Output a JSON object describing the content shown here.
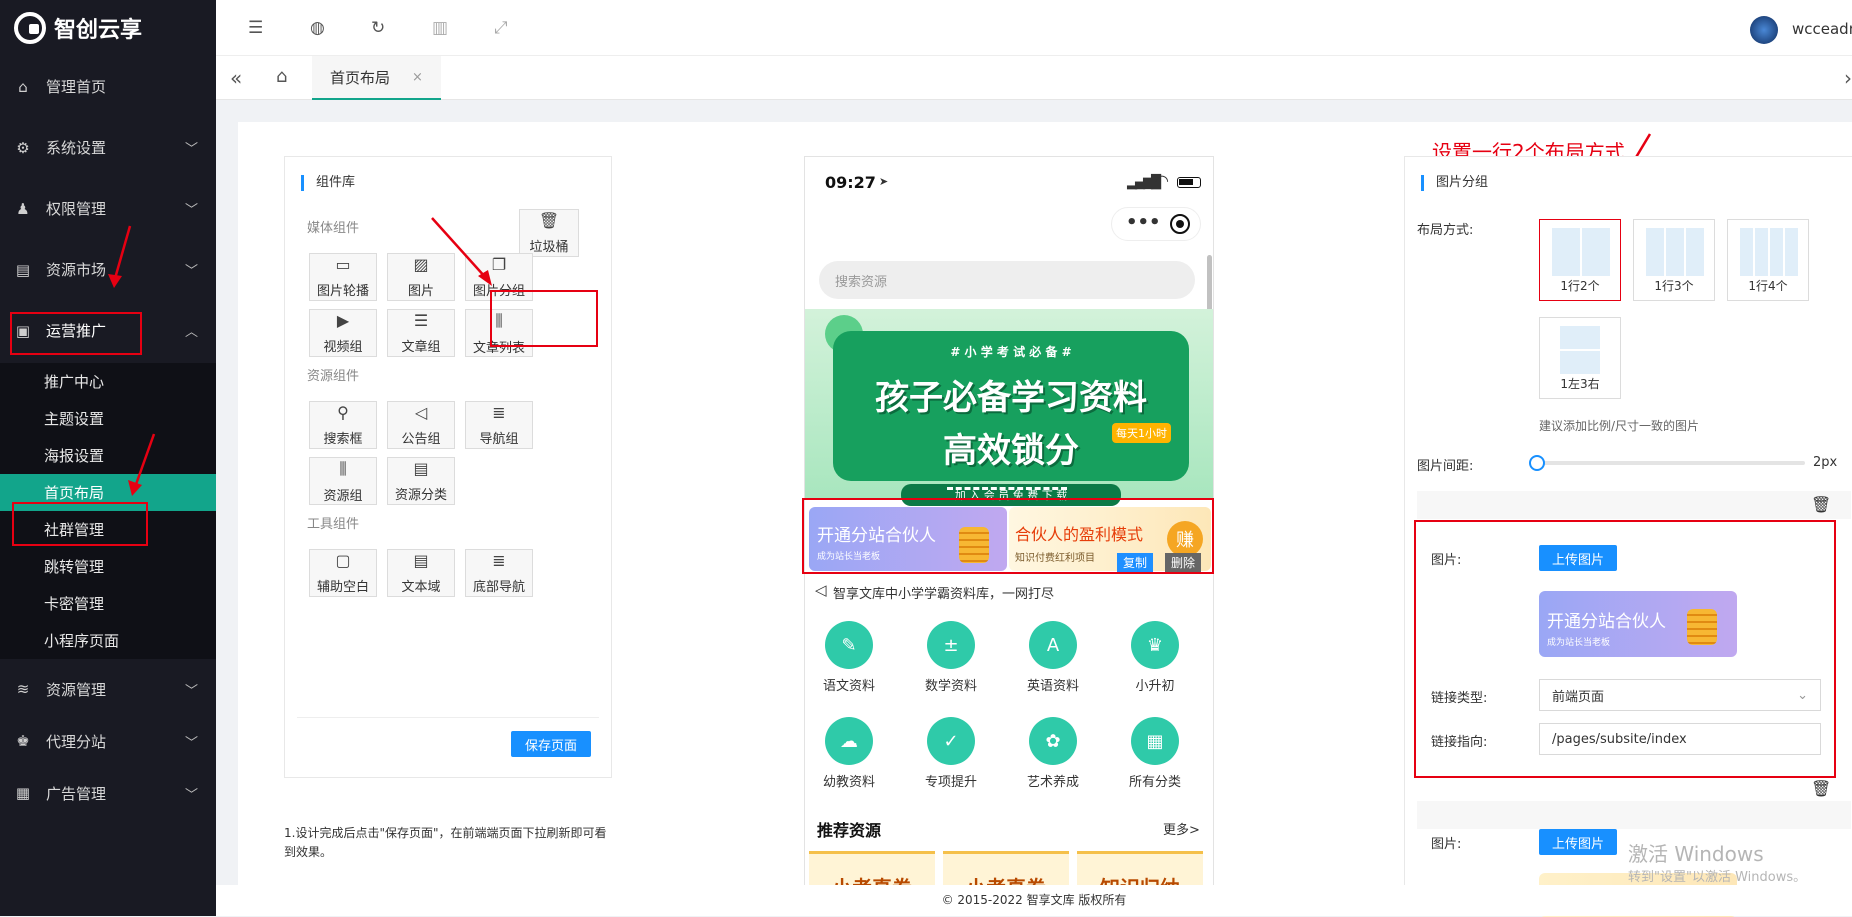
{
  "brand": {
    "name": "智创云享"
  },
  "sidebar": {
    "items": [
      {
        "label": "管理首页",
        "icon": "home-icon",
        "glyph": "⌂"
      },
      {
        "label": "系统设置",
        "icon": "gear-icon",
        "glyph": "⚙"
      },
      {
        "label": "权限管理",
        "icon": "users-icon",
        "glyph": "♟"
      },
      {
        "label": "资源市场",
        "icon": "store-icon",
        "glyph": "▤"
      },
      {
        "label": "运营推广",
        "icon": "promotion-icon",
        "glyph": "▣"
      }
    ],
    "sub_items": [
      "推广中心",
      "主题设置",
      "海报设置",
      "首页布局",
      "社群管理",
      "跳转管理",
      "卡密管理",
      "小程序页面"
    ],
    "bottom_items": [
      {
        "label": "资源管理",
        "icon": "layers-icon",
        "glyph": "≋"
      },
      {
        "label": "代理分站",
        "icon": "agent-icon",
        "glyph": "♚"
      },
      {
        "label": "广告管理",
        "icon": "ad-icon",
        "glyph": "▦"
      }
    ]
  },
  "topbar": {
    "user": "wcceadmin"
  },
  "tabs": [
    {
      "label": "首页布局"
    }
  ],
  "library": {
    "title": "组件库",
    "trash": "垃圾桶",
    "groups": [
      {
        "title": "媒体组件",
        "items": [
          {
            "label": "图片轮播",
            "glyph": "▭"
          },
          {
            "label": "图片",
            "glyph": "▨"
          },
          {
            "label": "图片分组",
            "glyph": "❐"
          },
          {
            "label": "视频组",
            "glyph": "▶"
          },
          {
            "label": "文章组",
            "glyph": "☰"
          },
          {
            "label": "文章列表",
            "glyph": "⫼"
          }
        ]
      },
      {
        "title": "资源组件",
        "items": [
          {
            "label": "搜索框",
            "glyph": "⚲"
          },
          {
            "label": "公告组",
            "glyph": "◁"
          },
          {
            "label": "导航组",
            "glyph": "≣"
          },
          {
            "label": "资源组",
            "glyph": "⫼"
          },
          {
            "label": "资源分类",
            "glyph": "▤"
          }
        ]
      },
      {
        "title": "工具组件",
        "items": [
          {
            "label": "辅助空白",
            "glyph": "▢"
          },
          {
            "label": "文本域",
            "glyph": "▤"
          },
          {
            "label": "底部导航",
            "glyph": "≣"
          }
        ]
      }
    ],
    "save": "保存页面",
    "note": "1.设计完成后点击\"保存页面\"，在前端端页面下拉刷新即可看到效果。"
  },
  "phone": {
    "time": "09:27",
    "search_placeholder": "搜索资源",
    "banner": {
      "tag": "# 小 学 考 试 必 备 #",
      "line1": "孩子必备学习资料",
      "line2": "高效锁分",
      "badge": "每天1小时",
      "foot": "加 入 会 员   免 费 下 载"
    },
    "promo_left": {
      "title": "开通分站合伙人",
      "sub": "成为站长当老板"
    },
    "promo_right": {
      "title": "合伙人的盈利模式",
      "sub": "知识付费红利项目",
      "coin": "赚"
    },
    "copy": "复制",
    "delete": "删除",
    "notice": "智享文库中小学学霸资料库，一网打尽",
    "grid": [
      {
        "label": "语文资料",
        "glyph": "✎"
      },
      {
        "label": "数学资料",
        "glyph": "±"
      },
      {
        "label": "英语资料",
        "glyph": "A"
      },
      {
        "label": "小升初",
        "glyph": "♛"
      },
      {
        "label": "幼教资料",
        "glyph": "☁"
      },
      {
        "label": "专项提升",
        "glyph": "✓"
      },
      {
        "label": "艺术养成",
        "glyph": "✿"
      },
      {
        "label": "所有分类",
        "glyph": "▦"
      }
    ],
    "rec_title": "推荐资源",
    "rec_more": "更多>",
    "rec_cards": [
      "小考真卷",
      "小考真卷",
      "知识归纳"
    ]
  },
  "config": {
    "annotation": "设置一行2个布局方式",
    "title": "图片分组",
    "layout_label": "布局方式:",
    "layouts": [
      {
        "label": "1行2个",
        "cols": 2
      },
      {
        "label": "1行3个",
        "cols": 3
      },
      {
        "label": "1行4个",
        "cols": 4
      },
      {
        "label": "1左3右",
        "cols": 2
      }
    ],
    "hint": "建议添加比例/尺寸一致的图片",
    "gap_label": "图片间距:",
    "gap_value": "2px",
    "gap_level": 0,
    "image_label": "图片:",
    "upload": "上传图片",
    "link_type_label": "链接类型:",
    "link_type": "前端页面",
    "link_to_label": "链接指向:",
    "link_to": "/pages/subsite/index",
    "preview": {
      "title": "开通分站合伙人",
      "sub": "成为站长当老板"
    }
  },
  "watermark": {
    "line1": "激活 Windows",
    "line2": "转到\"设置\"以激活 Windows。"
  },
  "footer": "© 2015-2022 智享文库 版权所有",
  "colors": {
    "sidebar": "#191a23",
    "active": "#12a58b",
    "accent": "#1890ff",
    "annotation": "#e60012"
  }
}
